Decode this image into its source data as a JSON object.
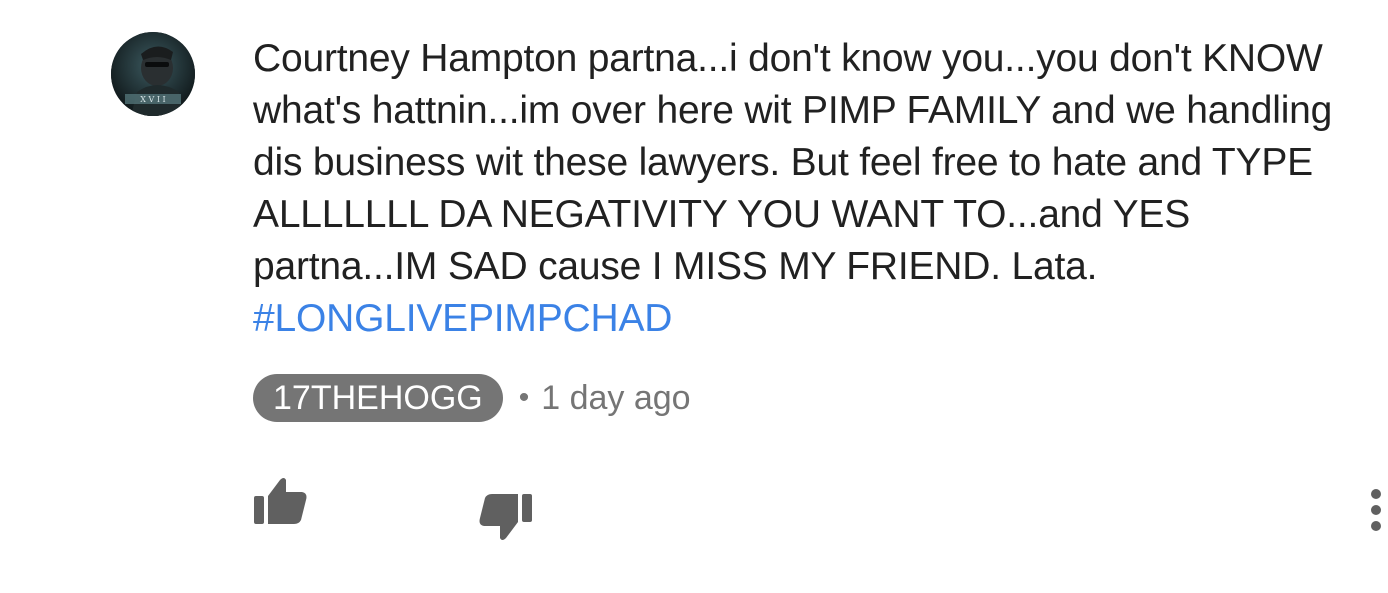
{
  "comment": {
    "avatar_icon": "avatar-image",
    "text_plain": "Courtney Hampton partna...i don't know you...you don't KNOW what's hattnin...im over here wit PIMP FAMILY and we handling dis business wit these lawyers. But feel free to hate and TYPE ALLLLLLL DA NEGATIVITY YOU WANT TO...and YES partna...IM SAD cause I MISS MY FRIEND. Lata. ",
    "hashtag": "#LONGLIVEPIMPCHAD",
    "author": "17THEHOGG",
    "separator": "•",
    "timestamp": "1 day ago"
  },
  "actions": {
    "like_icon": "thumbs-up-icon",
    "dislike_icon": "thumbs-down-icon",
    "more_icon": "more-vertical-icon"
  },
  "colors": {
    "text": "#212121",
    "hashtag": "#3b82e6",
    "chip_bg": "#757575",
    "meta": "#757575",
    "icon": "#606060"
  }
}
